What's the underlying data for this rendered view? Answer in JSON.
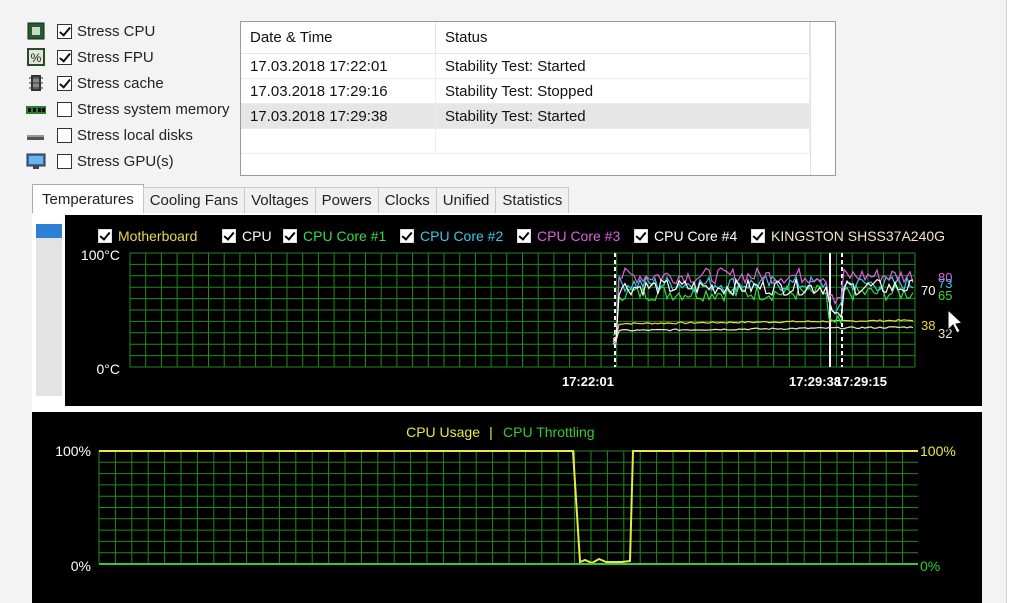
{
  "stress_options": [
    {
      "label": "Stress CPU",
      "checked": true,
      "icon": "cpu-chip-icon"
    },
    {
      "label": "Stress FPU",
      "checked": true,
      "icon": "percent-fpu-icon"
    },
    {
      "label": "Stress cache",
      "checked": true,
      "icon": "cache-chip-icon"
    },
    {
      "label": "Stress system memory",
      "checked": false,
      "icon": "memory-module-icon"
    },
    {
      "label": "Stress local disks",
      "checked": false,
      "icon": "disk-drive-icon"
    },
    {
      "label": "Stress GPU(s)",
      "checked": false,
      "icon": "monitor-gpu-icon"
    }
  ],
  "log": {
    "columns": [
      "Date & Time",
      "Status"
    ],
    "rows": [
      [
        "17.03.2018 17:22:01",
        "Stability Test: Started"
      ],
      [
        "17.03.2018 17:29:16",
        "Stability Test: Stopped"
      ],
      [
        "17.03.2018 17:29:38",
        "Stability Test: Started"
      ]
    ]
  },
  "tabs": [
    "Temperatures",
    "Cooling Fans",
    "Voltages",
    "Powers",
    "Clocks",
    "Unified",
    "Statistics"
  ],
  "temp_graph": {
    "legend": [
      {
        "label": "Motherboard",
        "color": "#e8d84a"
      },
      {
        "label": "CPU",
        "color": "#ffffff"
      },
      {
        "label": "CPU Core #1",
        "color": "#33dd44"
      },
      {
        "label": "CPU Core #2",
        "color": "#38c8e8"
      },
      {
        "label": "CPU Core #3",
        "color": "#e060e0"
      },
      {
        "label": "CPU Core #4",
        "color": "#ffffff"
      },
      {
        "label": "KINGSTON SHSS37A240G",
        "color": "#f2e8c4"
      }
    ],
    "y_top": "100°C",
    "y_bottom": "0°C",
    "time_labels": [
      "17:22:01",
      "17:29:38",
      "17:29:15"
    ],
    "end_values": [
      {
        "text": "80",
        "color": "#e060e0"
      },
      {
        "text": "73",
        "color": "#38c8e8"
      },
      {
        "text": "70",
        "color": "#ffffff"
      },
      {
        "text": "65",
        "color": "#33dd44"
      },
      {
        "text": "38",
        "color": "#e8d84a"
      },
      {
        "text": "32",
        "color": "#f2e8c4"
      }
    ]
  },
  "usage_graph": {
    "title_usage": "CPU Usage",
    "separator": "|",
    "title_throttling": "CPU Throttling",
    "usage_color": "#e8e84a",
    "throttle_color": "#33cc33",
    "y_left_top": "100%",
    "y_left_bottom": "0%",
    "y_right_top": "100%",
    "y_right_bottom": "0%"
  },
  "chart_data": [
    {
      "type": "line",
      "y_range": [
        0,
        100
      ],
      "y_unit": "°C",
      "series": [
        {
          "name": "Motherboard",
          "color": "#e8d84a",
          "end_value": 38
        },
        {
          "name": "CPU Core #1",
          "color": "#33dd44",
          "end_value": 65
        },
        {
          "name": "CPU Core #2",
          "color": "#38c8e8",
          "end_value": 73
        },
        {
          "name": "CPU Core #3",
          "color": "#e060e0",
          "end_value": 80
        },
        {
          "name": "CPU",
          "color": "#ffffff",
          "end_value": 70
        },
        {
          "name": "KINGSTON SHSS37A240G",
          "color": "#f2e8c4",
          "end_value": 32
        }
      ],
      "events": [
        "17:22:01",
        "17:29:38",
        "17:29:15"
      ]
    },
    {
      "type": "line",
      "y_range": [
        0,
        100
      ],
      "y_unit": "%",
      "series": [
        {
          "name": "CPU Usage",
          "color": "#e8e84a"
        },
        {
          "name": "CPU Throttling",
          "color": "#33cc33",
          "value": 0
        }
      ]
    }
  ]
}
